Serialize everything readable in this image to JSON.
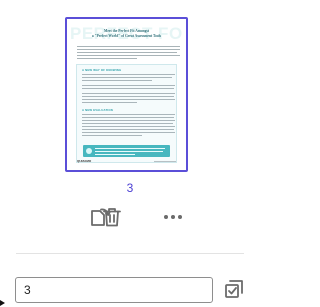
{
  "thumbnail": {
    "watermark": "PERFECT FORM",
    "title_line1": "Meet the Perfect Fit Amongst",
    "title_line2": "a \"Perfect World\" of Great Assessment Tools",
    "section1_heading": "A NEW WAY OF KNOWING",
    "section2_heading": "A NEW EVALUATION",
    "footer_logo": "QUIZAMO"
  },
  "page": {
    "number": "3"
  },
  "actions": {
    "rotate_icon": "rotate-page-icon",
    "delete_icon": "trash-icon",
    "more_icon": "more-horizontal-icon"
  },
  "page_input": {
    "value": "3"
  },
  "select_icon": "select-checkbox-icon",
  "colors": {
    "accent": "#5b4fd8",
    "page_number": "#4b3fd3",
    "icon": "#6b6b6b",
    "teal": "#47b7bf"
  }
}
